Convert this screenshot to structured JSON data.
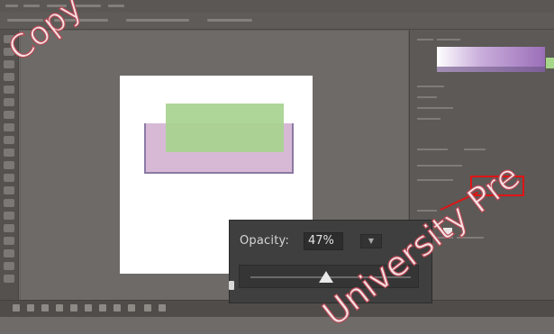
{
  "opacity_popup": {
    "label": "Opacity:",
    "value": "47%",
    "level_percent": 47
  },
  "watermark": {
    "segments": [
      "Copy - Ca",
      "University Pre"
    ]
  },
  "colors": {
    "highlight": "#e01414",
    "shape_green": "#a7d38f",
    "shape_pink": "#d7b9d6",
    "canvas": "#ffffff",
    "app_background": "#6f6b68"
  },
  "icons": [
    "lock-icon",
    "dropdown-arrow-icon",
    "slider-thumb-icon"
  ]
}
